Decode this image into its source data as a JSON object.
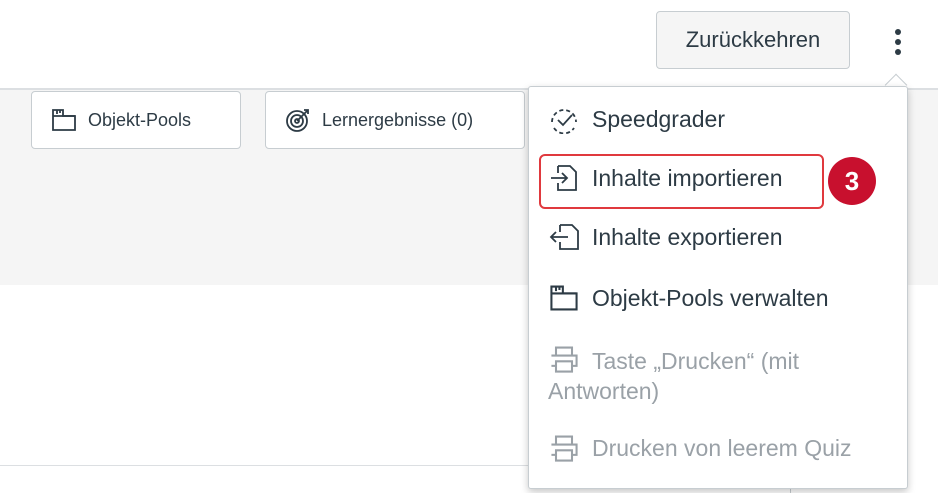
{
  "header": {
    "return_label": "Zurückkehren",
    "more_icon": "kebab-vertical-icon"
  },
  "toolbar": {
    "item_banks_label": "Objekt-Pools",
    "item_banks_icon": "item-bank-icon",
    "outcomes_label": "Lernergebnisse (0)",
    "outcomes_icon": "outcomes-target-icon"
  },
  "menu": {
    "items": [
      {
        "label": "Speedgrader",
        "icon": "speedgrader-icon",
        "enabled": true
      },
      {
        "label": "Inhalte importieren",
        "icon": "import-icon",
        "enabled": true
      },
      {
        "label": "Inhalte exportieren",
        "icon": "export-icon",
        "enabled": true
      },
      {
        "label": "Objekt-Pools verwalten",
        "icon": "item-bank-icon",
        "enabled": true
      },
      {
        "label_line1": "Taste „Drucken“ (mit",
        "label_line2": "Antworten)",
        "icon": "printer-icon",
        "enabled": false
      },
      {
        "label": "Drucken von leerem Quiz",
        "icon": "printer-icon",
        "enabled": false
      }
    ]
  },
  "annotation": {
    "step_number": "3",
    "color": "#c8102e",
    "highlight_color": "#e0393e"
  }
}
